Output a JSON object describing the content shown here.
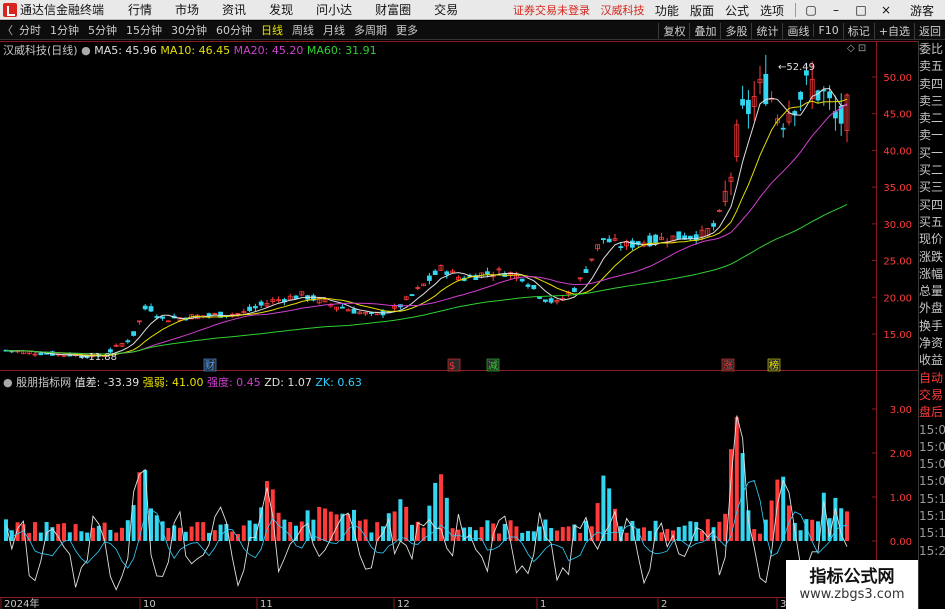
{
  "menubar": {
    "app_title": "通达信金融终端",
    "menus": [
      "行情",
      "市场",
      "资讯",
      "发现",
      "问小达",
      "财富圈",
      "交易"
    ],
    "notice": "证券交易未登录",
    "stock_name": "汉威科技",
    "right": [
      "功能",
      "版面",
      "公式",
      "选项"
    ],
    "guest": "游客",
    "win_controls": [
      "▢",
      "–",
      "□",
      "×"
    ]
  },
  "toolbar": {
    "back": "〈",
    "periods": [
      "分时",
      "1分钟",
      "5分钟",
      "15分钟",
      "30分钟",
      "60分钟",
      "日线",
      "周线",
      "月线",
      "多周期",
      "更多"
    ],
    "active_period": "日线",
    "right": [
      "复权",
      "叠加",
      "多股",
      "统计",
      "画线",
      "F10",
      "标记",
      "+自选",
      "返回"
    ]
  },
  "price_panel": {
    "title": "汉威科技(日线)",
    "ma": [
      {
        "label": "MA5: 45.96",
        "color": "#e0e0e0"
      },
      {
        "label": "MA10: 46.45",
        "color": "#e6e000"
      },
      {
        "label": "MA20: 45.20",
        "color": "#d040d0"
      },
      {
        "label": "MA60: 31.91",
        "color": "#30d030"
      }
    ],
    "y_ticks": [
      "50.00",
      "45.00",
      "40.00",
      "35.00",
      "30.00",
      "25.00",
      "20.00",
      "15.00"
    ],
    "high_label": "52.49",
    "low_label": "11.88",
    "markers": [
      {
        "text": "财",
        "color": "#4aa0ff"
      },
      {
        "text": "$",
        "color": "#ff3030"
      },
      {
        "text": "减",
        "color": "#30d030"
      },
      {
        "text": "涨",
        "color": "#ff3030"
      },
      {
        "text": "榜",
        "color": "#e6e000"
      }
    ]
  },
  "indicator_panel": {
    "name": "殷朋指标网",
    "values": [
      {
        "label": "值差: -33.39",
        "color": "#e0e0e0"
      },
      {
        "label": "强弱: 41.00",
        "color": "#e6e000"
      },
      {
        "label": "强度: 0.45",
        "color": "#d040d0"
      },
      {
        "label": "ZD: 1.07",
        "color": "#e0e0e0"
      },
      {
        "label": "ZK: 0.63",
        "color": "#30d0ff"
      }
    ],
    "y_ticks": [
      "3.00",
      "2.00",
      "1.00",
      "0.00"
    ]
  },
  "x_axis": [
    "2024年",
    "10",
    "11",
    "12",
    "1",
    "2",
    "3"
  ],
  "side_panel": [
    "委比",
    "卖五",
    "卖四",
    "卖三",
    "卖二",
    "卖一",
    "买一",
    "买二",
    "买三",
    "买四",
    "买五",
    "现价",
    "涨跌",
    "涨幅",
    "总量",
    "外盘",
    "换手",
    "净资",
    "收益",
    "自动",
    "交易",
    "盘后",
    "15:00",
    "15:03",
    "15:06",
    "15:09",
    "15:11",
    "15:13",
    "15:19",
    "15:25"
  ],
  "watermark": {
    "title": "指标公式网",
    "url": "www.zbgs3.com"
  },
  "colors": {
    "up": "#ff3a3a",
    "down": "#33d6f0",
    "ma5": "#e0e0e0",
    "ma10": "#e6e000",
    "ma20": "#d040d0",
    "ma60": "#30d030",
    "axis": "#8b1a1a"
  }
}
